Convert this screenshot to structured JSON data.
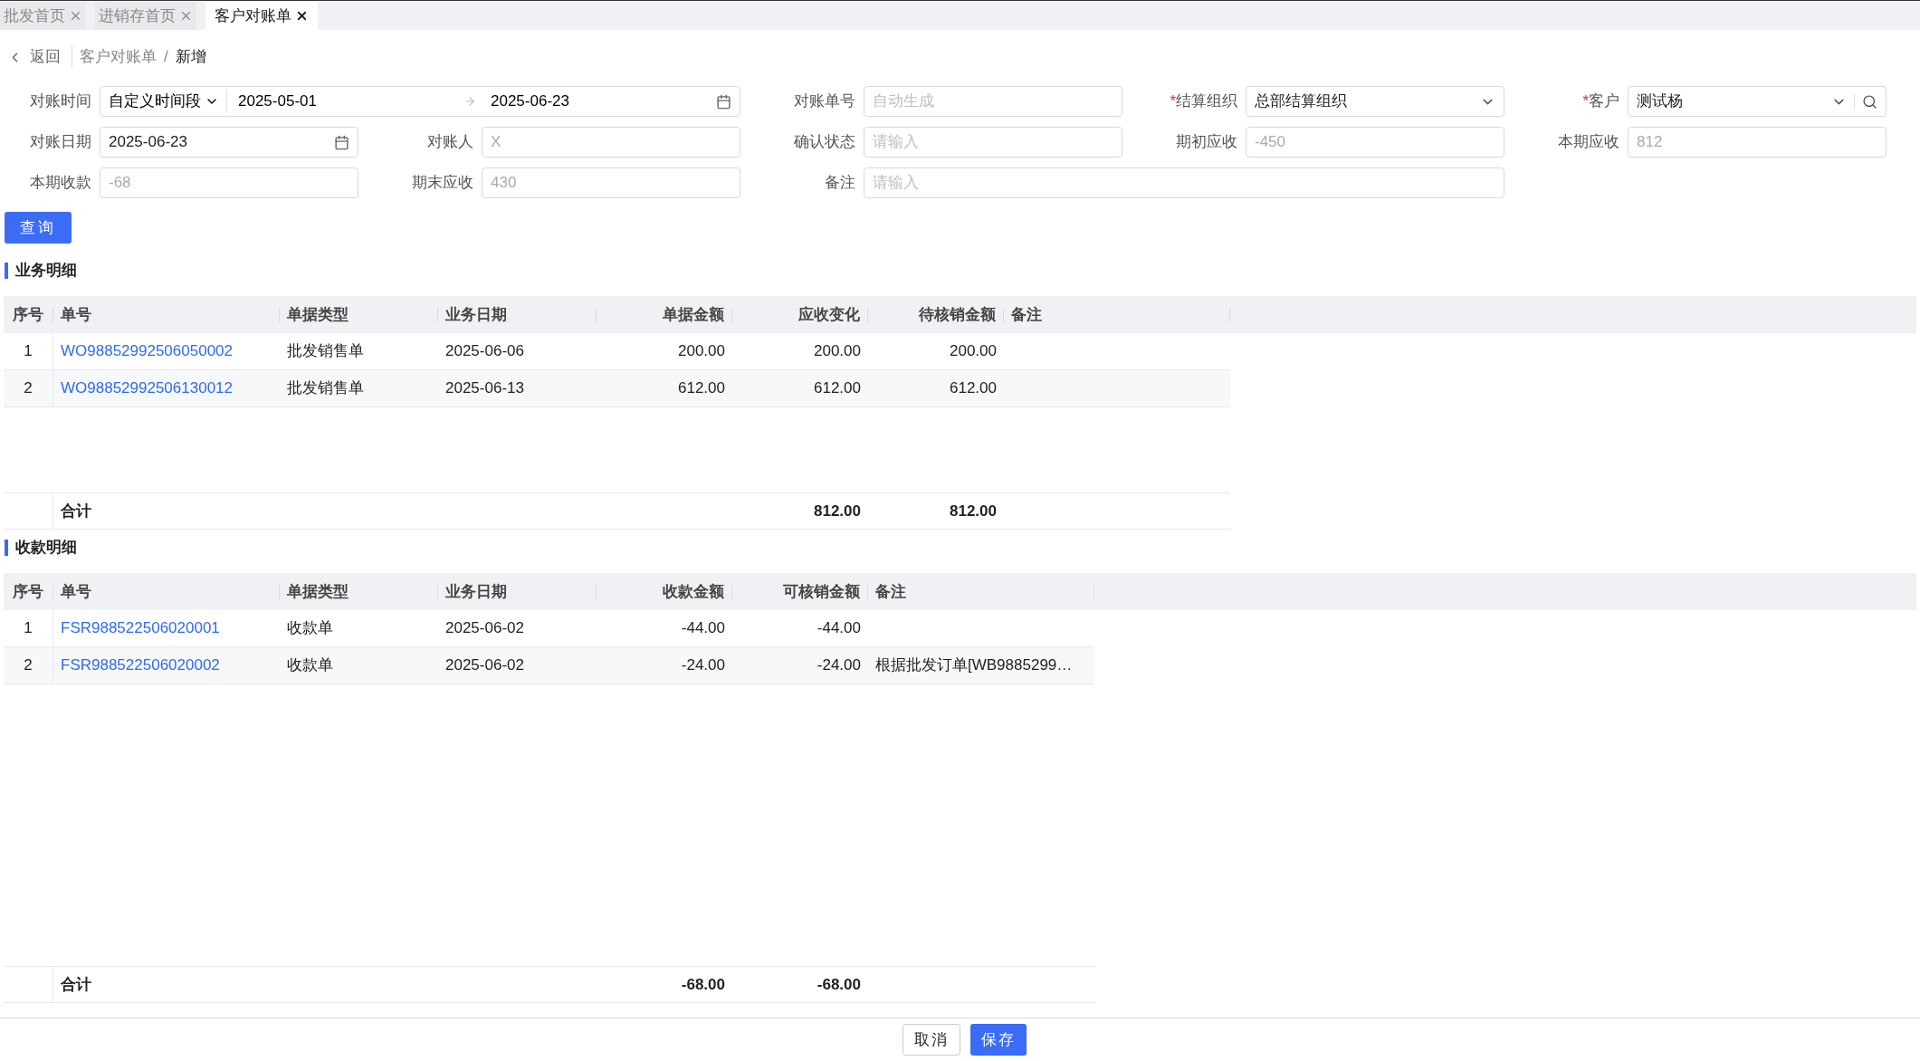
{
  "tabs": [
    {
      "label": "批发首页",
      "selected": false
    },
    {
      "label": "进销存首页",
      "selected": false
    },
    {
      "label": "客户对账单",
      "selected": true
    }
  ],
  "breadcrumb": {
    "back": "返回",
    "items": [
      "客户对账单",
      "新增"
    ],
    "separator": "/"
  },
  "form": {
    "required_mark": "*",
    "fields": [
      {
        "kind": "range",
        "label": "对账时间",
        "preset": "自定义时间段",
        "start": "2025-05-01",
        "end": "2025-06-23"
      },
      {
        "kind": "text",
        "label": "对账单号",
        "placeholder": "自动生成"
      },
      {
        "kind": "select",
        "label": "结算组织",
        "required": true,
        "value": "总部结算组织"
      },
      {
        "kind": "search-select",
        "label": "客户",
        "required": true,
        "value": "测试杨"
      },
      {
        "kind": "date",
        "label": "对账日期",
        "value": "2025-06-23"
      },
      {
        "kind": "text",
        "label": "对账人",
        "value": "X",
        "disabled": true
      },
      {
        "kind": "text",
        "label": "确认状态",
        "placeholder": "请输入"
      },
      {
        "kind": "text",
        "label": "期初应收",
        "value": "-450",
        "disabled": true
      },
      {
        "kind": "text",
        "label": "本期应收",
        "value": "812",
        "disabled": true
      },
      {
        "kind": "text",
        "label": "本期收款",
        "value": "-68",
        "disabled": true
      },
      {
        "kind": "text",
        "label": "期末应收",
        "value": "430",
        "disabled": true
      },
      {
        "kind": "wide",
        "label": "备注",
        "placeholder": "请输入"
      }
    ],
    "query_button": "查询"
  },
  "sections": [
    {
      "title": "业务明细",
      "columns": [
        {
          "label": "序号",
          "kind": "index"
        },
        {
          "label": "单号",
          "kind": "link"
        },
        {
          "label": "单据类型",
          "kind": "text"
        },
        {
          "label": "业务日期",
          "kind": "text"
        },
        {
          "label": "单据金额",
          "kind": "number"
        },
        {
          "label": "应收变化",
          "kind": "number"
        },
        {
          "label": "待核销金额",
          "kind": "number"
        },
        {
          "label": "备注",
          "kind": "text"
        }
      ],
      "rows": [
        [
          "1",
          "WO98852992506050002",
          "批发销售单",
          "2025-06-06",
          "200.00",
          "200.00",
          "200.00"
        ],
        [
          "2",
          "WO98852992506130012",
          "批发销售单",
          "2025-06-13",
          "612.00",
          "612.00",
          "612.00"
        ]
      ],
      "summary": {
        "label": "合计",
        "totals": [
          "812.00",
          "812.00"
        ]
      }
    },
    {
      "title": "收款明细",
      "columns": [
        {
          "label": "序号",
          "kind": "index"
        },
        {
          "label": "单号",
          "kind": "link"
        },
        {
          "label": "单据类型",
          "kind": "text"
        },
        {
          "label": "业务日期",
          "kind": "text"
        },
        {
          "label": "收款金额",
          "kind": "number"
        },
        {
          "label": "可核销金额",
          "kind": "number"
        },
        {
          "label": "备注",
          "kind": "text"
        }
      ],
      "rows": [
        [
          "1",
          "FSR988522506020001",
          "收款单",
          "2025-06-02",
          "-44.00",
          "-44.00"
        ],
        [
          "2",
          "FSR988522506020002",
          "收款单",
          "2025-06-02",
          "-24.00",
          "-24.00",
          "根据批发订单[WB9885299…"
        ]
      ],
      "summary": {
        "label": "合计",
        "totals": [
          "-68.00",
          "-68.00"
        ]
      }
    }
  ],
  "footer": {
    "cancel": "取消",
    "save": "保存"
  }
}
